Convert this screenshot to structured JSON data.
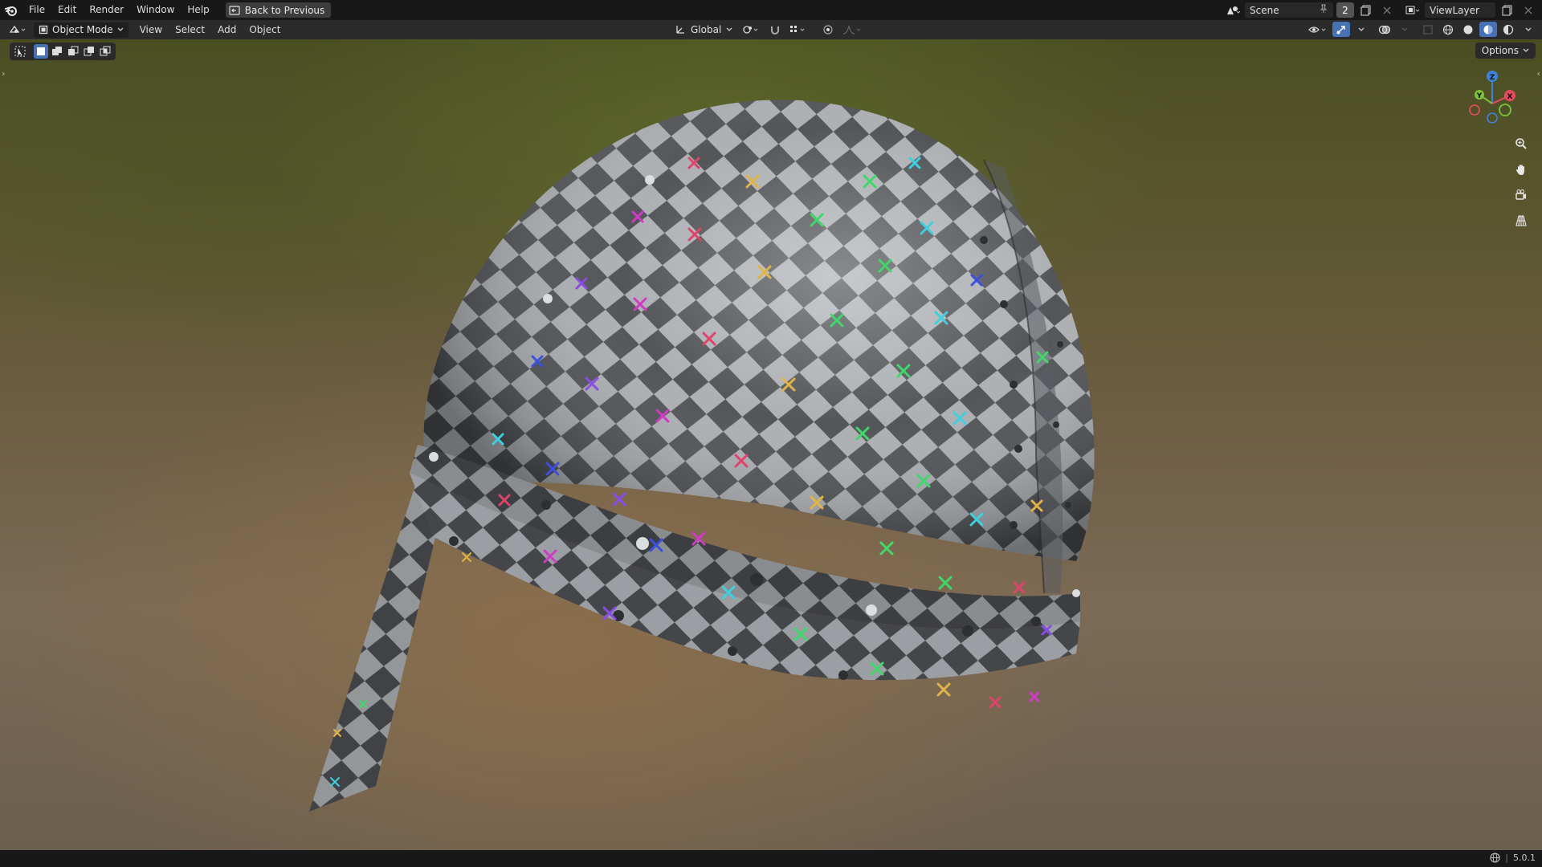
{
  "menubar": {
    "items": [
      "File",
      "Edit",
      "Render",
      "Window",
      "Help"
    ],
    "back_label": "Back to Previous",
    "scene_name": "Scene",
    "scene_count": "2",
    "view_layer": "ViewLayer"
  },
  "header": {
    "mode": "Object Mode",
    "menus": [
      "View",
      "Select",
      "Add",
      "Object"
    ],
    "transform_orientation": "Global"
  },
  "viewport": {
    "options_label": "Options",
    "gizmo_axes": [
      "X",
      "Y",
      "Z"
    ],
    "object": "checker-textured helmet mesh"
  },
  "statusbar": {
    "version": "5.0.1"
  },
  "colors": {
    "accent": "#4772b3",
    "axis_x": "#e84a5f",
    "axis_y": "#7ec23c",
    "axis_z": "#3f82d9"
  }
}
